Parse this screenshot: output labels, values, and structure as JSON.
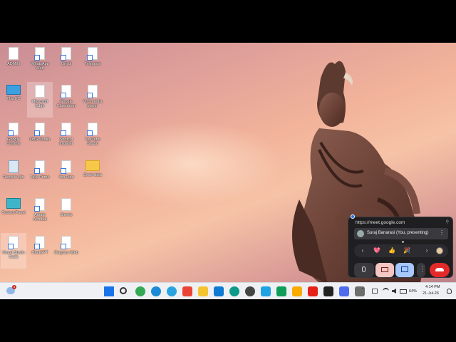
{
  "desktop_icons": [
    {
      "label": "ADMIN",
      "col": 0,
      "row": 0,
      "type": "file"
    },
    {
      "label": "WhatsApp Web",
      "col": 1,
      "row": 0,
      "type": "shortcut"
    },
    {
      "label": "Gmail",
      "col": 2,
      "row": 0,
      "type": "shortcut"
    },
    {
      "label": "Telegram",
      "col": 3,
      "row": 0,
      "type": "shortcut"
    },
    {
      "label": "This PC",
      "col": 0,
      "row": 1,
      "type": "pc"
    },
    {
      "label": "Microsoft Edge",
      "col": 1,
      "row": 1,
      "type": "file",
      "selected": true
    },
    {
      "label": "Google Classroom",
      "col": 2,
      "row": 1,
      "type": "shortcut"
    },
    {
      "label": "VLC media player",
      "col": 3,
      "row": 1,
      "type": "shortcut"
    },
    {
      "label": "Google Chrome",
      "col": 0,
      "row": 2,
      "type": "shortcut"
    },
    {
      "label": "OBS Studio",
      "col": 1,
      "row": 2,
      "type": "shortcut"
    },
    {
      "label": "Shotcut Installer",
      "col": 2,
      "row": 2,
      "type": "shortcut"
    },
    {
      "label": "YouTube Studio",
      "col": 3,
      "row": 2,
      "type": "shortcut"
    },
    {
      "label": "Recycle Bin",
      "col": 0,
      "row": 3,
      "type": "bin"
    },
    {
      "label": "Tally Prime",
      "col": 1,
      "row": 3,
      "type": "shortcut"
    },
    {
      "label": "YouTube",
      "col": 2,
      "row": 3,
      "type": "shortcut"
    },
    {
      "label": "Excel data",
      "col": 3,
      "row": 3,
      "type": "folder"
    },
    {
      "label": "Control Panel",
      "col": 0,
      "row": 4,
      "type": "cp"
    },
    {
      "label": "Adobe Acrobat",
      "col": 1,
      "row": 4,
      "type": "shortcut"
    },
    {
      "label": "Sheets",
      "col": 2,
      "row": 4,
      "type": "file"
    },
    {
      "label": "Visual Studio Code",
      "col": 0,
      "row": 5,
      "type": "shortcut",
      "selected": true
    },
    {
      "label": "ChatGPT",
      "col": 1,
      "row": 5,
      "type": "shortcut"
    },
    {
      "label": "Diagram Web",
      "col": 2,
      "row": 5,
      "type": "shortcut"
    }
  ],
  "meet_popup": {
    "url": "https://meet.google.com",
    "presenter": "Suraj Banarasi (You, presenting)",
    "reactions": [
      "💖",
      "👍",
      "🎉"
    ]
  },
  "taskbar": {
    "weather_badge": "1",
    "apps": [
      {
        "name": "start-icon",
        "color": "#1a73e8"
      },
      {
        "name": "search-icon",
        "color": "#333333"
      },
      {
        "name": "chrome-icon",
        "color": "#34a853"
      },
      {
        "name": "edge-icon",
        "color": "#1c8bd6"
      },
      {
        "name": "telegram-icon",
        "color": "#2aa3e0"
      },
      {
        "name": "gmail-icon",
        "color": "#ea4335"
      },
      {
        "name": "explorer-icon",
        "color": "#f4c430"
      },
      {
        "name": "vscode-icon",
        "color": "#0e7ad1"
      },
      {
        "name": "edge-active-icon",
        "color": "#0d9a8a"
      },
      {
        "name": "chatgpt-icon",
        "color": "#444444"
      },
      {
        "name": "store-icon",
        "color": "#1fa3e5"
      },
      {
        "name": "sheets-icon",
        "color": "#0f9d58"
      },
      {
        "name": "classroom-icon",
        "color": "#f9ab00"
      },
      {
        "name": "youtube-icon",
        "color": "#e62117"
      },
      {
        "name": "obs-icon",
        "color": "#222222"
      },
      {
        "name": "photos-icon",
        "color": "#4f6bed"
      },
      {
        "name": "settings-icon",
        "color": "#6d6d6d"
      }
    ],
    "battery": "64%",
    "time": "4:14 PM",
    "date": "21-Jul-26"
  }
}
